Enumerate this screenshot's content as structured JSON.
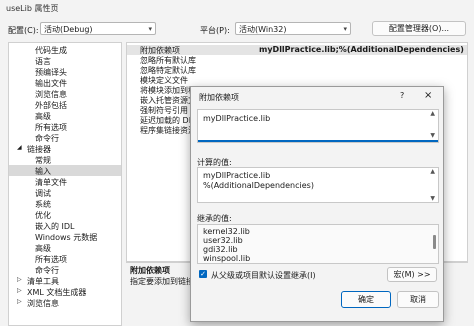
{
  "window": {
    "title": "useLib 属性页"
  },
  "config": {
    "config_label": "配置(C):",
    "config_value": "活动(Debug)",
    "platform_label": "平台(P):",
    "platform_value": "活动(Win32)",
    "manager_button": "配置管理器(O)..."
  },
  "tree": {
    "items": [
      "代码生成",
      "语言",
      "预编译头",
      "输出文件",
      "浏览信息",
      "外部包括",
      "高级",
      "所有选项",
      "命令行",
      "链接器",
      "常规",
      "输入",
      "清单文件",
      "调试",
      "系统",
      "优化",
      "嵌入的 IDL",
      "Windows 元数据",
      "高级",
      "所有选项",
      "命令行",
      "清单工具",
      "XML 文档生成器",
      "浏览信息"
    ]
  },
  "grid": {
    "rows": [
      "附加依赖项",
      "忽略所有默认库",
      "忽略特定默认库",
      "模块定义文件",
      "将模块添加到程序",
      "嵌入托管资源文件",
      "强制符号引用",
      "延迟加载的 DLL",
      "程序集链接资源"
    ],
    "first_value": "myDllPractice.lib;%(AdditionalDependencies)"
  },
  "description": {
    "title": "附加依赖项",
    "text": "指定要添加到链接命"
  },
  "dialog": {
    "title": "附加依赖项",
    "help": "?",
    "close": "×",
    "edit_lines": [
      "myDllPractice.lib"
    ],
    "evaluated_label": "计算的值:",
    "evaluated_lines": [
      "myDllPractice.lib",
      "%(AdditionalDependencies)"
    ],
    "inherited_label": "继承的值:",
    "inherited_lines": [
      "kernel32.lib",
      "user32.lib",
      "gdi32.lib",
      "winspool.lib"
    ],
    "inherit_checkbox": "从父级或项目默认设置继承(I)",
    "macro_button": "宏(M) >>",
    "ok_button": "确定",
    "cancel_button": "取消"
  },
  "colors": {
    "accent": "#0067c0",
    "selection": "#d9d9d9"
  }
}
